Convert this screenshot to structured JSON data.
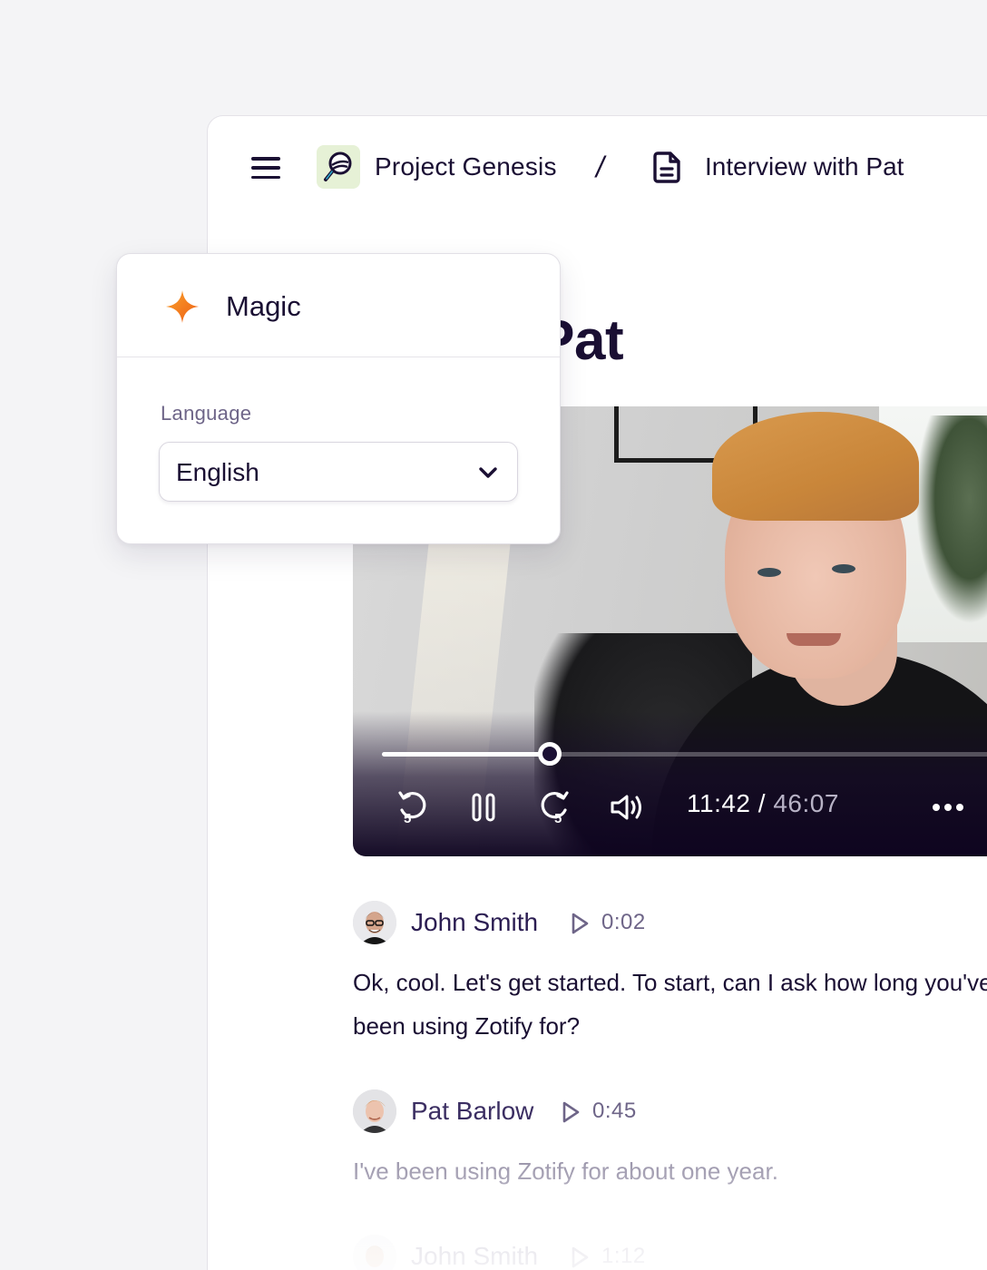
{
  "breadcrumb": {
    "project": "Project Genesis",
    "separator": "/",
    "document": "Interview with Pat"
  },
  "page": {
    "title_visible": "w with Pat"
  },
  "player": {
    "current_time": "11:42",
    "separator": "/",
    "total_time": "46:07",
    "progress_fraction": 0.2535,
    "rewind_seconds": "5",
    "forward_seconds": "5"
  },
  "transcript": [
    {
      "speaker": "John Smith",
      "timestamp": "0:02",
      "text": "Ok, cool. Let's get started. To start, can I ask how long you've been using Zotify for?"
    },
    {
      "speaker": "Pat Barlow",
      "timestamp": "0:45",
      "text": "I've been using Zotify for about one year."
    },
    {
      "speaker": "John Smith",
      "timestamp": "1:12",
      "text": ""
    }
  ],
  "magic_panel": {
    "title": "Magic",
    "language_label": "Language",
    "language_value": "English"
  },
  "colors": {
    "text_primary": "#1a0f33",
    "accent_spark": "#f47a1f",
    "project_logo_bg": "#e6f1d6",
    "player_overlay": "#0e0420"
  },
  "icons": {
    "menu": "hamburger-icon",
    "project": "magnifier-logo-icon",
    "document": "document-icon",
    "rewind": "rewind-5-icon",
    "pause": "pause-icon",
    "forward": "forward-5-icon",
    "volume": "volume-icon",
    "more": "more-horizontal-icon",
    "play": "play-icon",
    "spark": "sparkle-icon",
    "chevron": "chevron-down-icon"
  }
}
